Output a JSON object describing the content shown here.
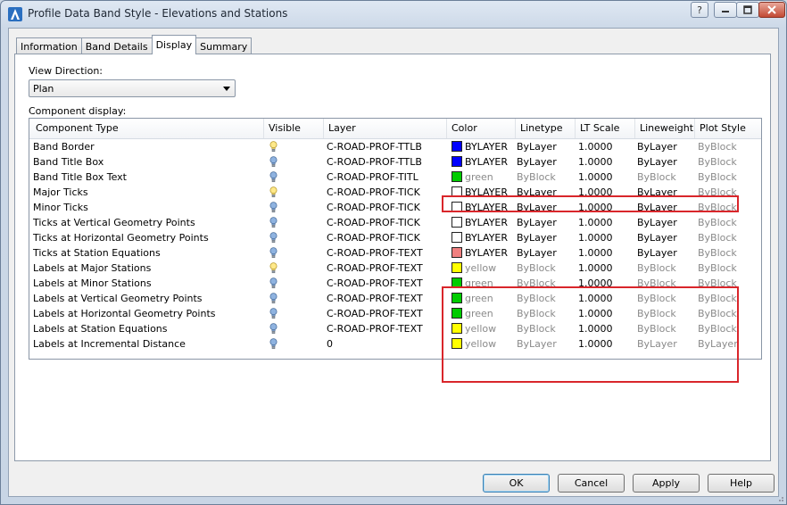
{
  "window": {
    "title": "Profile Data Band Style - Elevations and Stations",
    "icon": "autocad-civil-icon"
  },
  "window_controls": {
    "help": "?",
    "minimize": "minimize-icon",
    "maximize": "maximize-icon",
    "close": "close-icon"
  },
  "tabs": [
    {
      "label": "Information"
    },
    {
      "label": "Band Details"
    },
    {
      "label": "Display"
    },
    {
      "label": "Summary"
    }
  ],
  "active_tab": "Display",
  "view_direction": {
    "label": "View Direction:",
    "value": "Plan"
  },
  "component_display": {
    "label": "Component display:",
    "columns": [
      "Component Type",
      "Visible",
      "Layer",
      "Color",
      "Linetype",
      "LT Scale",
      "Lineweight",
      "Plot Style"
    ],
    "rows": [
      {
        "type": "Band Border",
        "visible": "on",
        "layer": "C-ROAD-PROF-TTLB",
        "color": "BYLAYER",
        "swatch": "#0000ff",
        "linetype": "ByLayer",
        "ltscale": "1.0000",
        "lineweight": "ByLayer",
        "plotstyle": "ByBlock",
        "dim": false
      },
      {
        "type": "Band Title Box",
        "visible": "off",
        "layer": "C-ROAD-PROF-TTLB",
        "color": "BYLAYER",
        "swatch": "#0000ff",
        "linetype": "ByLayer",
        "ltscale": "1.0000",
        "lineweight": "ByLayer",
        "plotstyle": "ByBlock",
        "dim": false
      },
      {
        "type": "Band Title Box Text",
        "visible": "off",
        "layer": "C-ROAD-PROF-TITL",
        "color": "green",
        "swatch": "#00cc00",
        "linetype": "ByBlock",
        "ltscale": "1.0000",
        "lineweight": "ByBlock",
        "plotstyle": "ByBlock",
        "dim": true
      },
      {
        "type": "Major Ticks",
        "visible": "on",
        "layer": "C-ROAD-PROF-TICK",
        "color": "BYLAYER",
        "swatch": "#ffffff",
        "linetype": "ByLayer",
        "ltscale": "1.0000",
        "lineweight": "ByLayer",
        "plotstyle": "ByBlock",
        "dim": false
      },
      {
        "type": "Minor Ticks",
        "visible": "off",
        "layer": "C-ROAD-PROF-TICK",
        "color": "BYLAYER",
        "swatch": "#ffffff",
        "linetype": "ByLayer",
        "ltscale": "1.0000",
        "lineweight": "ByLayer",
        "plotstyle": "ByBlock",
        "dim": false
      },
      {
        "type": "Ticks at Vertical Geometry Points",
        "visible": "off",
        "layer": "C-ROAD-PROF-TICK",
        "color": "BYLAYER",
        "swatch": "#ffffff",
        "linetype": "ByLayer",
        "ltscale": "1.0000",
        "lineweight": "ByLayer",
        "plotstyle": "ByBlock",
        "dim": false
      },
      {
        "type": "Ticks at Horizontal Geometry Points",
        "visible": "off",
        "layer": "C-ROAD-PROF-TICK",
        "color": "BYLAYER",
        "swatch": "#ffffff",
        "linetype": "ByLayer",
        "ltscale": "1.0000",
        "lineweight": "ByLayer",
        "plotstyle": "ByBlock",
        "dim": false
      },
      {
        "type": "Ticks at Station Equations",
        "visible": "off",
        "layer": "C-ROAD-PROF-TEXT",
        "color": "BYLAYER",
        "swatch": "#f08080",
        "linetype": "ByLayer",
        "ltscale": "1.0000",
        "lineweight": "ByLayer",
        "plotstyle": "ByBlock",
        "dim": false
      },
      {
        "type": "Labels at Major Stations",
        "visible": "on",
        "layer": "C-ROAD-PROF-TEXT",
        "color": "yellow",
        "swatch": "#ffff00",
        "linetype": "ByBlock",
        "ltscale": "1.0000",
        "lineweight": "ByBlock",
        "plotstyle": "ByBlock",
        "dim": true
      },
      {
        "type": "Labels at Minor Stations",
        "visible": "off",
        "layer": "C-ROAD-PROF-TEXT",
        "color": "green",
        "swatch": "#00cc00",
        "linetype": "ByBlock",
        "ltscale": "1.0000",
        "lineweight": "ByBlock",
        "plotstyle": "ByBlock",
        "dim": true
      },
      {
        "type": "Labels at Vertical Geometry Points",
        "visible": "off",
        "layer": "C-ROAD-PROF-TEXT",
        "color": "green",
        "swatch": "#00cc00",
        "linetype": "ByBlock",
        "ltscale": "1.0000",
        "lineweight": "ByBlock",
        "plotstyle": "ByBlock",
        "dim": true
      },
      {
        "type": "Labels at Horizontal Geometry Points",
        "visible": "off",
        "layer": "C-ROAD-PROF-TEXT",
        "color": "green",
        "swatch": "#00cc00",
        "linetype": "ByBlock",
        "ltscale": "1.0000",
        "lineweight": "ByBlock",
        "plotstyle": "ByBlock",
        "dim": true
      },
      {
        "type": "Labels at Station Equations",
        "visible": "off",
        "layer": "C-ROAD-PROF-TEXT",
        "color": "yellow",
        "swatch": "#ffff00",
        "linetype": "ByBlock",
        "ltscale": "1.0000",
        "lineweight": "ByBlock",
        "plotstyle": "ByBlock",
        "dim": true
      },
      {
        "type": "Labels at Incremental Distance",
        "visible": "off",
        "layer": "0",
        "color": "yellow",
        "swatch": "#ffff00",
        "linetype": "ByLayer",
        "ltscale": "1.0000",
        "lineweight": "ByLayer",
        "plotstyle": "ByLayer",
        "dim": true
      }
    ]
  },
  "buttons": {
    "ok": "OK",
    "cancel": "Cancel",
    "apply": "Apply",
    "help": "Help"
  },
  "colors": {
    "highlight": "#d9262b",
    "bulb_on": "#ffe98a",
    "bulb_off": "#8fb3e0",
    "dim_text": "#8a8a8a"
  }
}
